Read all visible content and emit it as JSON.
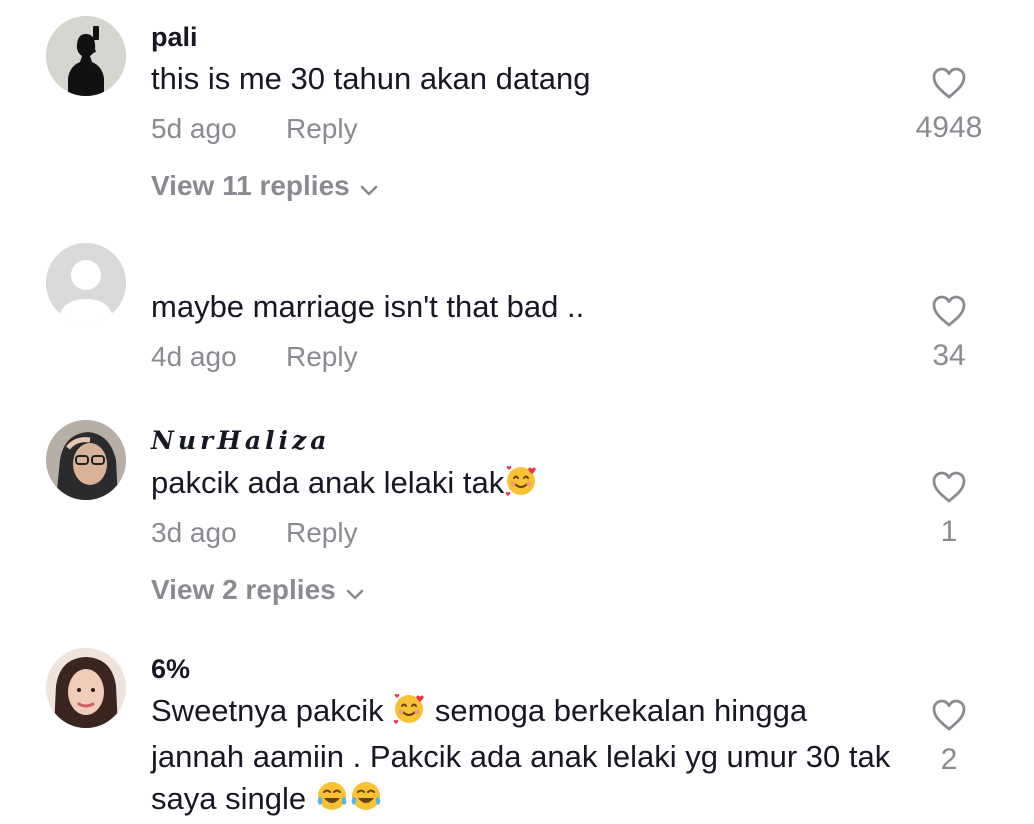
{
  "comments": [
    {
      "username": "pali",
      "text": "this is me 30 tahun akan datang",
      "time": "5d ago",
      "reply_label": "Reply",
      "likes": "4948",
      "view_replies": "View 11 replies"
    },
    {
      "username": "",
      "text": "maybe marriage isn't that bad ..",
      "time": "4d ago",
      "reply_label": "Reply",
      "likes": "34"
    },
    {
      "username": "NurHaliza",
      "text": "pakcik ada anak lelaki tak",
      "time": "3d ago",
      "reply_label": "Reply",
      "likes": "1",
      "view_replies": "View 2 replies"
    },
    {
      "username": "6%",
      "text_part1": "Sweetnya pakcik",
      "text_part2": "semoga berkekalan hingga jannah aamiin . Pakcik ada anak lelaki yg umur 30 tak saya single",
      "likes": "2"
    }
  ],
  "colors": {
    "primary_text": "#161823",
    "secondary_text": "#8a8b91",
    "icon": "#8a8b91"
  }
}
